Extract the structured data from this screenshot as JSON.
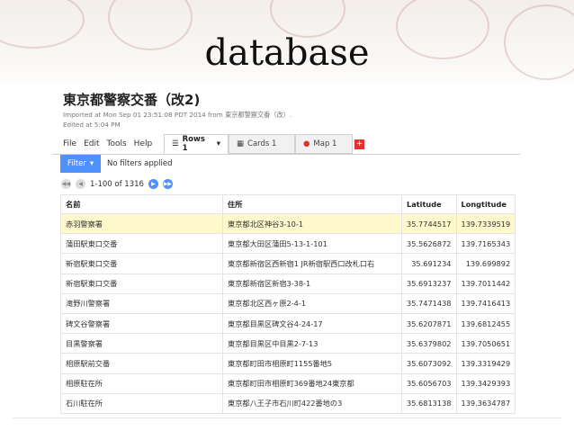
{
  "slide": {
    "title": "database"
  },
  "document": {
    "title": "東京都警察交番（改2)",
    "meta_line1": "Imported at Mon Sep 01 23:51:08 PDT 2014 from 東京都警察交番（改）.",
    "meta_line2": "Edited at 5:04 PM"
  },
  "menu": {
    "file": "File",
    "edit": "Edit",
    "tools": "Tools",
    "help": "Help"
  },
  "tabs": {
    "rows": "Rows 1",
    "cards": "Cards 1",
    "map": "Map 1",
    "add": "+"
  },
  "filter": {
    "button": "Filter",
    "status": "No filters applied"
  },
  "pager": {
    "range": "1-100 of 1316"
  },
  "table": {
    "headers": {
      "name": "名前",
      "address": "住所",
      "latitude": "Latitude",
      "longitude": "Longtitude"
    },
    "rows": [
      {
        "name": "赤羽警察署",
        "address": "東京都北区神谷3-10-1",
        "lat": "35.7744517",
        "lng": "139.7339519"
      },
      {
        "name": "蒲田駅東口交番",
        "address": "東京都大田区蒲田5-13-1-101",
        "lat": "35.5626872",
        "lng": "139.7165343"
      },
      {
        "name": "新宿駅東口交番",
        "address": "東京都新宿区西新宿1 JR新宿駅西口改札口右",
        "lat": "35.691234",
        "lng": "139.699892"
      },
      {
        "name": "新宿駅東口交番",
        "address": "東京都新宿区新宿3-38-1",
        "lat": "35.6913237",
        "lng": "139.7011442"
      },
      {
        "name": "滝野川警察署",
        "address": "東京都北区西ヶ原2-4-1",
        "lat": "35.7471438",
        "lng": "139.7416413"
      },
      {
        "name": "碑文谷警察署",
        "address": "東京都目黒区碑文谷4-24-17",
        "lat": "35.6207871",
        "lng": "139.6812455"
      },
      {
        "name": "目黒警察署",
        "address": "東京都目黒区中目黒2-7-13",
        "lat": "35.6379802",
        "lng": "139.7050651"
      },
      {
        "name": "相原駅前交番",
        "address": "東京都町田市相原町1155番地5",
        "lat": "35.6073092",
        "lng": "139.3319429"
      },
      {
        "name": "相原駐在所",
        "address": "東京都町田市相原町369番地24東京都",
        "lat": "35.6056703",
        "lng": "139.3429393"
      },
      {
        "name": "石川駐在所",
        "address": "東京都八王子市石川町422番地の3",
        "lat": "35.6813138",
        "lng": "139.3634787"
      }
    ]
  }
}
